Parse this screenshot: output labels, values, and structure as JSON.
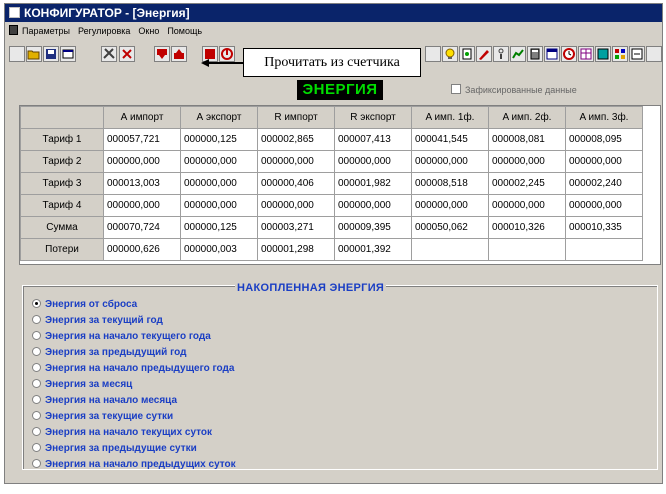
{
  "window": {
    "title": "КОНФИГУРАТОР - [Энергия]"
  },
  "menu": {
    "items": [
      "Параметры",
      "Регулировка",
      "Окно",
      "Помощь"
    ]
  },
  "toolbar": {
    "tooltip": "Прочитать из счетчика"
  },
  "energy": {
    "title": "ЭНЕРГИЯ",
    "fixed_label": "Зафиксированные данные",
    "fixed_checked": false,
    "columns": [
      "А импорт",
      "А экспорт",
      "R импорт",
      "R экспорт",
      "A имп. 1ф.",
      "A имп. 2ф.",
      "A имп. 3ф."
    ],
    "rows": [
      {
        "label": "Тариф 1",
        "values": [
          "000057,721",
          "000000,125",
          "000002,865",
          "000007,413",
          "000041,545",
          "000008,081",
          "000008,095"
        ]
      },
      {
        "label": "Тариф 2",
        "values": [
          "000000,000",
          "000000,000",
          "000000,000",
          "000000,000",
          "000000,000",
          "000000,000",
          "000000,000"
        ]
      },
      {
        "label": "Тариф 3",
        "values": [
          "000013,003",
          "000000,000",
          "000000,406",
          "000001,982",
          "000008,518",
          "000002,245",
          "000002,240"
        ]
      },
      {
        "label": "Тариф 4",
        "values": [
          "000000,000",
          "000000,000",
          "000000,000",
          "000000,000",
          "000000,000",
          "000000,000",
          "000000,000"
        ]
      },
      {
        "label": "Сумма",
        "values": [
          "000070,724",
          "000000,125",
          "000003,271",
          "000009,395",
          "000050,062",
          "000010,326",
          "000010,335"
        ]
      },
      {
        "label": "Потери",
        "values": [
          "000000,626",
          "000000,003",
          "000001,298",
          "000001,392",
          "",
          "",
          ""
        ]
      }
    ]
  },
  "accumulated": {
    "title": "НАКОПЛЕННАЯ  ЭНЕРГИЯ",
    "selected_index": 0,
    "options": [
      "Энергия от сброса",
      "Энергия за текущий год",
      "Энергия на начало текущего года",
      "Энергия за предыдущий год",
      "Энергия на начало предыдущего года",
      "Энергия за месяц",
      "Энергия на начало месяца",
      "Энергия за текущие сутки",
      "Энергия на начало текущих суток",
      "Энергия за предыдущие сутки",
      "Энергия на начало предыдущих суток"
    ]
  },
  "colors": {
    "title_bar": "#0a246a",
    "window_bg": "#d4d0c8",
    "energy_title_bg": "#000000",
    "energy_title_fg": "#00dd00",
    "option_text": "#1a3ec4"
  }
}
